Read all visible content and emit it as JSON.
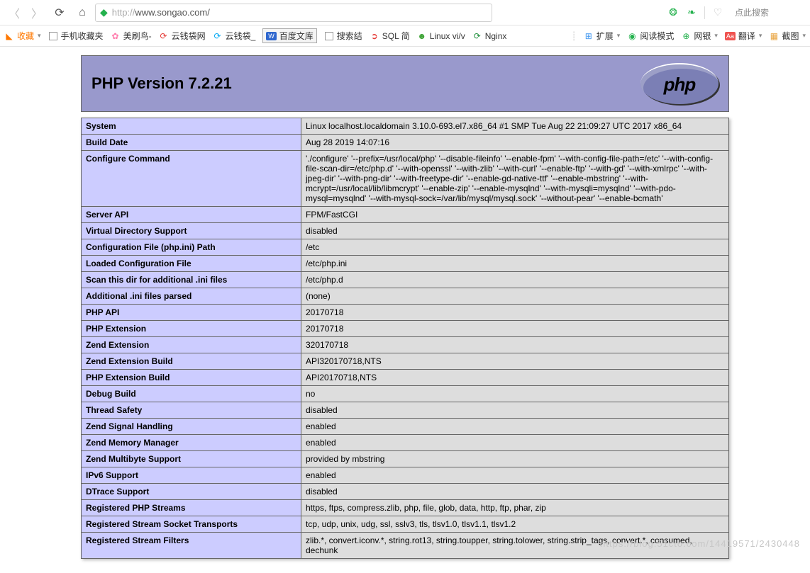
{
  "browser": {
    "url_scheme": "http://",
    "url_rest": "www.songao.com/",
    "search_hint": "点此搜索"
  },
  "bookmarks_left": [
    {
      "icon": "square",
      "label": "收藏",
      "chev": true,
      "cls": ""
    },
    {
      "icon": "square",
      "label": "手机收藏夹",
      "chev": false,
      "cls": ""
    },
    {
      "icon": "meishua",
      "glyph": "✿",
      "label": "美刷鸟-",
      "chev": false
    },
    {
      "icon": "yun1",
      "glyph": "⟳",
      "label": "云钱袋网",
      "chev": false
    },
    {
      "icon": "yun2",
      "glyph": "⟳",
      "label": "云钱袋_",
      "chev": false
    },
    {
      "icon": "baidu",
      "glyph": "",
      "label": "百度文库",
      "chev": false,
      "boxed": true
    },
    {
      "icon": "square",
      "label": "搜索结",
      "chev": false
    },
    {
      "icon": "sqlj",
      "glyph": "➲",
      "label": "SQL 简",
      "chev": false
    },
    {
      "icon": "linux",
      "glyph": "☻",
      "label": "Linux vi/v",
      "chev": false
    },
    {
      "icon": "nginx",
      "glyph": "⟳",
      "label": "Nginx",
      "chev": false
    }
  ],
  "bookmarks_right": [
    {
      "glyph": "⊞",
      "cls": "",
      "label": "扩展",
      "chev": true,
      "color": "#555"
    },
    {
      "glyph": "◉",
      "cls": "read-ic",
      "label": "阅读模式",
      "chev": false
    },
    {
      "glyph": "⊕",
      "cls": "bank-ic",
      "label": "网银",
      "chev": true
    },
    {
      "glyph": "Aa",
      "cls": "trans-box",
      "label": "翻译",
      "chev": true,
      "box": true
    },
    {
      "glyph": "▦",
      "cls": "shot-ic",
      "label": "截图",
      "chev": true
    }
  ],
  "php": {
    "title": "PHP Version 7.2.21",
    "logo_text": "php",
    "rows": [
      {
        "k": "System",
        "v": "Linux localhost.localdomain 3.10.0-693.el7.x86_64 #1 SMP Tue Aug 22 21:09:27 UTC 2017 x86_64"
      },
      {
        "k": "Build Date",
        "v": "Aug 28 2019 14:07:16"
      },
      {
        "k": "Configure Command",
        "v": "'./configure' '--prefix=/usr/local/php' '--disable-fileinfo' '--enable-fpm' '--with-config-file-path=/etc' '--with-config-file-scan-dir=/etc/php.d' '--with-openssl' '--with-zlib' '--with-curl' '--enable-ftp' '--with-gd' '--with-xmlrpc' '--with-jpeg-dir' '--with-png-dir' '--with-freetype-dir' '--enable-gd-native-ttf' '--enable-mbstring' '--with-mcrypt=/usr/local/lib/libmcrypt' '--enable-zip' '--enable-mysqlnd' '--with-mysqli=mysqlnd' '--with-pdo-mysql=mysqlnd' '--with-mysql-sock=/var/lib/mysql/mysql.sock' '--without-pear' '--enable-bcmath'"
      },
      {
        "k": "Server API",
        "v": "FPM/FastCGI"
      },
      {
        "k": "Virtual Directory Support",
        "v": "disabled"
      },
      {
        "k": "Configuration File (php.ini) Path",
        "v": "/etc"
      },
      {
        "k": "Loaded Configuration File",
        "v": "/etc/php.ini"
      },
      {
        "k": "Scan this dir for additional .ini files",
        "v": "/etc/php.d"
      },
      {
        "k": "Additional .ini files parsed",
        "v": "(none)"
      },
      {
        "k": "PHP API",
        "v": "20170718"
      },
      {
        "k": "PHP Extension",
        "v": "20170718"
      },
      {
        "k": "Zend Extension",
        "v": "320170718"
      },
      {
        "k": "Zend Extension Build",
        "v": "API320170718,NTS"
      },
      {
        "k": "PHP Extension Build",
        "v": "API20170718,NTS"
      },
      {
        "k": "Debug Build",
        "v": "no"
      },
      {
        "k": "Thread Safety",
        "v": "disabled"
      },
      {
        "k": "Zend Signal Handling",
        "v": "enabled"
      },
      {
        "k": "Zend Memory Manager",
        "v": "enabled"
      },
      {
        "k": "Zend Multibyte Support",
        "v": "provided by mbstring"
      },
      {
        "k": "IPv6 Support",
        "v": "enabled"
      },
      {
        "k": "DTrace Support",
        "v": "disabled"
      },
      {
        "k": "Registered PHP Streams",
        "v": "https, ftps, compress.zlib, php, file, glob, data, http, ftp, phar, zip"
      },
      {
        "k": "Registered Stream Socket Transports",
        "v": "tcp, udp, unix, udg, ssl, sslv3, tls, tlsv1.0, tlsv1.1, tlsv1.2"
      },
      {
        "k": "Registered Stream Filters",
        "v": "zlib.*, convert.iconv.*, string.rot13, string.toupper, string.tolower, string.strip_tags, convert.*, consumed, dechunk"
      }
    ]
  },
  "watermark": "https://blog.51cto.com/14419571/2430448"
}
